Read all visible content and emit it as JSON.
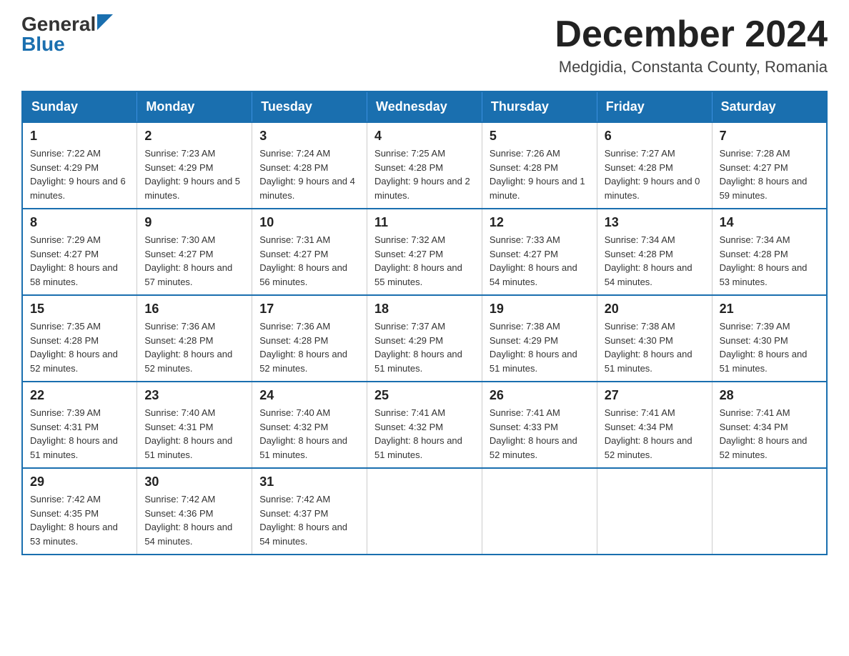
{
  "logo": {
    "general": "General",
    "blue": "Blue",
    "arrow": "▲"
  },
  "header": {
    "month_year": "December 2024",
    "location": "Medgidia, Constanta County, Romania"
  },
  "days_of_week": [
    "Sunday",
    "Monday",
    "Tuesday",
    "Wednesday",
    "Thursday",
    "Friday",
    "Saturday"
  ],
  "weeks": [
    [
      {
        "day": "1",
        "sunrise": "7:22 AM",
        "sunset": "4:29 PM",
        "daylight": "9 hours and 6 minutes."
      },
      {
        "day": "2",
        "sunrise": "7:23 AM",
        "sunset": "4:29 PM",
        "daylight": "9 hours and 5 minutes."
      },
      {
        "day": "3",
        "sunrise": "7:24 AM",
        "sunset": "4:28 PM",
        "daylight": "9 hours and 4 minutes."
      },
      {
        "day": "4",
        "sunrise": "7:25 AM",
        "sunset": "4:28 PM",
        "daylight": "9 hours and 2 minutes."
      },
      {
        "day": "5",
        "sunrise": "7:26 AM",
        "sunset": "4:28 PM",
        "daylight": "9 hours and 1 minute."
      },
      {
        "day": "6",
        "sunrise": "7:27 AM",
        "sunset": "4:28 PM",
        "daylight": "9 hours and 0 minutes."
      },
      {
        "day": "7",
        "sunrise": "7:28 AM",
        "sunset": "4:27 PM",
        "daylight": "8 hours and 59 minutes."
      }
    ],
    [
      {
        "day": "8",
        "sunrise": "7:29 AM",
        "sunset": "4:27 PM",
        "daylight": "8 hours and 58 minutes."
      },
      {
        "day": "9",
        "sunrise": "7:30 AM",
        "sunset": "4:27 PM",
        "daylight": "8 hours and 57 minutes."
      },
      {
        "day": "10",
        "sunrise": "7:31 AM",
        "sunset": "4:27 PM",
        "daylight": "8 hours and 56 minutes."
      },
      {
        "day": "11",
        "sunrise": "7:32 AM",
        "sunset": "4:27 PM",
        "daylight": "8 hours and 55 minutes."
      },
      {
        "day": "12",
        "sunrise": "7:33 AM",
        "sunset": "4:27 PM",
        "daylight": "8 hours and 54 minutes."
      },
      {
        "day": "13",
        "sunrise": "7:34 AM",
        "sunset": "4:28 PM",
        "daylight": "8 hours and 54 minutes."
      },
      {
        "day": "14",
        "sunrise": "7:34 AM",
        "sunset": "4:28 PM",
        "daylight": "8 hours and 53 minutes."
      }
    ],
    [
      {
        "day": "15",
        "sunrise": "7:35 AM",
        "sunset": "4:28 PM",
        "daylight": "8 hours and 52 minutes."
      },
      {
        "day": "16",
        "sunrise": "7:36 AM",
        "sunset": "4:28 PM",
        "daylight": "8 hours and 52 minutes."
      },
      {
        "day": "17",
        "sunrise": "7:36 AM",
        "sunset": "4:28 PM",
        "daylight": "8 hours and 52 minutes."
      },
      {
        "day": "18",
        "sunrise": "7:37 AM",
        "sunset": "4:29 PM",
        "daylight": "8 hours and 51 minutes."
      },
      {
        "day": "19",
        "sunrise": "7:38 AM",
        "sunset": "4:29 PM",
        "daylight": "8 hours and 51 minutes."
      },
      {
        "day": "20",
        "sunrise": "7:38 AM",
        "sunset": "4:30 PM",
        "daylight": "8 hours and 51 minutes."
      },
      {
        "day": "21",
        "sunrise": "7:39 AM",
        "sunset": "4:30 PM",
        "daylight": "8 hours and 51 minutes."
      }
    ],
    [
      {
        "day": "22",
        "sunrise": "7:39 AM",
        "sunset": "4:31 PM",
        "daylight": "8 hours and 51 minutes."
      },
      {
        "day": "23",
        "sunrise": "7:40 AM",
        "sunset": "4:31 PM",
        "daylight": "8 hours and 51 minutes."
      },
      {
        "day": "24",
        "sunrise": "7:40 AM",
        "sunset": "4:32 PM",
        "daylight": "8 hours and 51 minutes."
      },
      {
        "day": "25",
        "sunrise": "7:41 AM",
        "sunset": "4:32 PM",
        "daylight": "8 hours and 51 minutes."
      },
      {
        "day": "26",
        "sunrise": "7:41 AM",
        "sunset": "4:33 PM",
        "daylight": "8 hours and 52 minutes."
      },
      {
        "day": "27",
        "sunrise": "7:41 AM",
        "sunset": "4:34 PM",
        "daylight": "8 hours and 52 minutes."
      },
      {
        "day": "28",
        "sunrise": "7:41 AM",
        "sunset": "4:34 PM",
        "daylight": "8 hours and 52 minutes."
      }
    ],
    [
      {
        "day": "29",
        "sunrise": "7:42 AM",
        "sunset": "4:35 PM",
        "daylight": "8 hours and 53 minutes."
      },
      {
        "day": "30",
        "sunrise": "7:42 AM",
        "sunset": "4:36 PM",
        "daylight": "8 hours and 54 minutes."
      },
      {
        "day": "31",
        "sunrise": "7:42 AM",
        "sunset": "4:37 PM",
        "daylight": "8 hours and 54 minutes."
      },
      null,
      null,
      null,
      null
    ]
  ]
}
